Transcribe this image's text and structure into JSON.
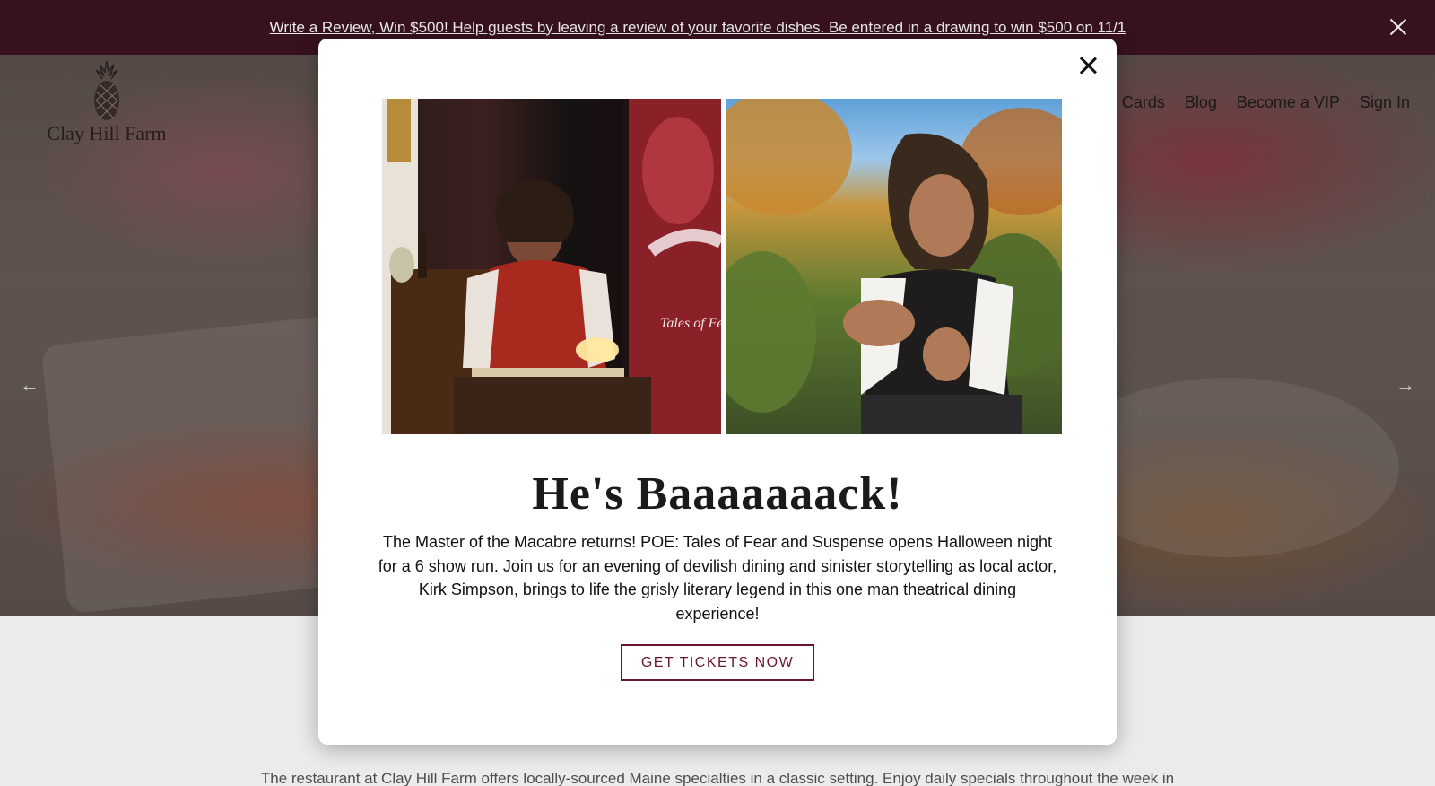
{
  "announcement": {
    "text": "Write a Review, Win $500! Help guests by leaving a review of your favorite dishes. Be entered in a drawing to win $500 on 11/1",
    "close_icon": "close-icon"
  },
  "logo": {
    "text": "Clay Hill Farm",
    "icon": "pineapple-icon"
  },
  "nav": {
    "items": [
      {
        "label": "Cards"
      },
      {
        "label": "Blog"
      },
      {
        "label": "Become a VIP"
      },
      {
        "label": "Sign In"
      }
    ]
  },
  "hero": {
    "prev_icon": "arrow-left-icon",
    "next_icon": "arrow-right-icon"
  },
  "intro": {
    "text": "The restaurant at Clay Hill Farm offers locally-sourced Maine specialties in a classic setting. Enjoy daily specials throughout the week in"
  },
  "modal": {
    "title": "He's Baaaaaaack!",
    "body": "The Master of the Macabre returns! POE: Tales of Fear and Suspense opens Halloween night for a 6 show run. Join us for an evening of devilish dining and sinister storytelling as local actor, Kirk Simpson, brings to life the grisly literary legend in this one man theatrical dining experience!",
    "cta_label": "GET TICKETS NOW",
    "poster_text": "Tales of Fear",
    "close_icon": "close-icon"
  },
  "colors": {
    "announcement_bg": "#3d1322",
    "accent": "#6b1430",
    "modal_bg": "#ffffff"
  }
}
